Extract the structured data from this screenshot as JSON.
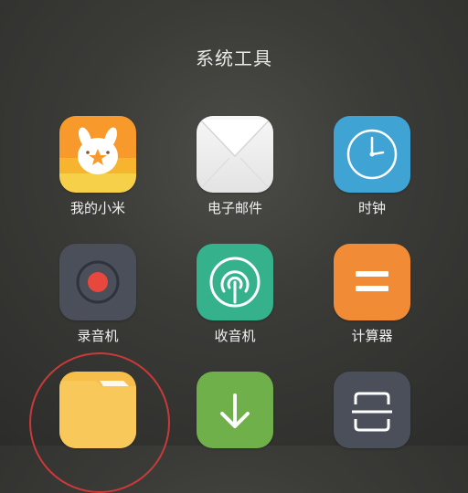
{
  "folder": {
    "title": "系统工具"
  },
  "apps": {
    "mi": {
      "label": "我的小米"
    },
    "email": {
      "label": "电子邮件"
    },
    "clock": {
      "label": "时钟"
    },
    "recorder": {
      "label": "录音机"
    },
    "radio": {
      "label": "收音机"
    },
    "calculator": {
      "label": "计算器"
    },
    "files": {
      "label": ""
    },
    "downloads": {
      "label": ""
    },
    "scanner": {
      "label": ""
    }
  },
  "colors": {
    "highlight": "#c83a3a"
  },
  "icons": [
    "mi-bunny-icon",
    "envelope-icon",
    "clock-icon",
    "record-icon",
    "radio-signal-icon",
    "equals-icon",
    "folder-icon",
    "download-arrow-icon",
    "scanner-icon"
  ]
}
